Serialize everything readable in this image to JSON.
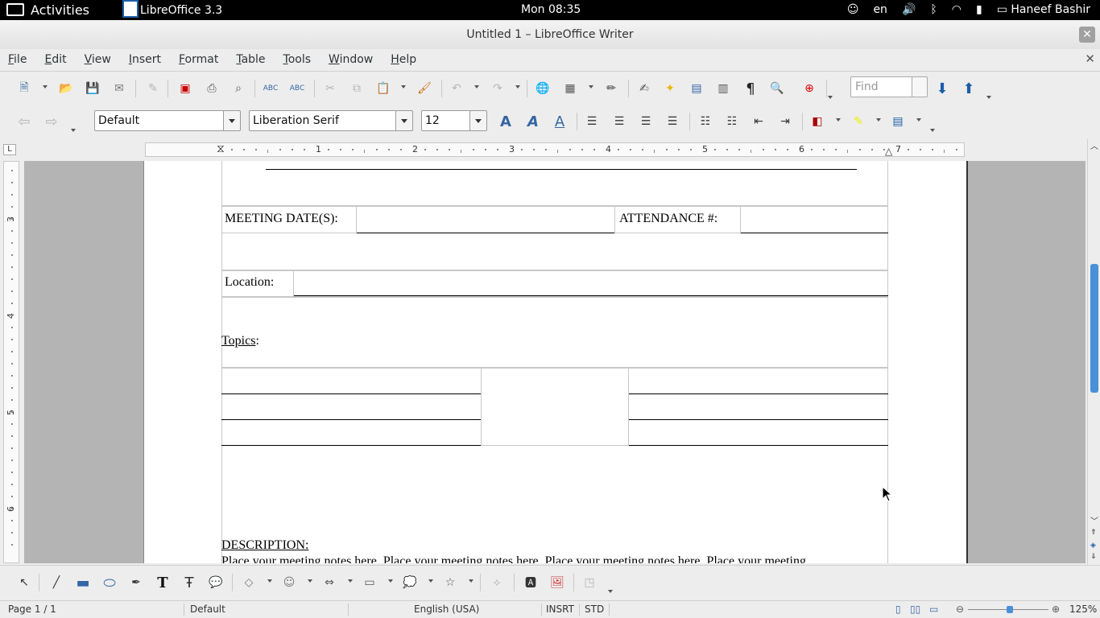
{
  "topbar": {
    "activities": "Activities",
    "app_name": "LibreOffice 3.3",
    "clock": "Mon 08:35",
    "language": "en",
    "user": "Haneef Bashir"
  },
  "window": {
    "title": "Untitled 1 – LibreOffice Writer"
  },
  "menu": [
    "File",
    "Edit",
    "View",
    "Insert",
    "Format",
    "Table",
    "Tools",
    "Window",
    "Help"
  ],
  "toolbar": {
    "find_placeholder": "Find"
  },
  "formatting": {
    "style": "Default",
    "font": "Liberation Serif",
    "size": "12"
  },
  "ruler": {
    "h_numbers": [
      "1",
      "2",
      "3",
      "4",
      "5",
      "6",
      "7"
    ],
    "v_numbers": [
      "3",
      "4",
      "5",
      "6"
    ]
  },
  "document": {
    "meeting_dates_label": "MEETING DATE(S):",
    "attendance_label": "ATTENDANCE #:",
    "location_label": "Location:",
    "topics_label": "Topics",
    "description_label": "DESCRIPTION:",
    "notes_line": "Place your meeting notes here. Place your meeting notes here. Place your meeting notes here. Place your meeting"
  },
  "status": {
    "page": "Page 1 / 1",
    "style": "Default",
    "language": "English (USA)",
    "insert_mode": "INSRT",
    "selection_mode": "STD",
    "zoom": "125%"
  },
  "icons": [
    "accessibility-icon",
    "volume-icon",
    "bluetooth-icon",
    "wifi-icon",
    "battery-icon",
    "user-icon"
  ]
}
